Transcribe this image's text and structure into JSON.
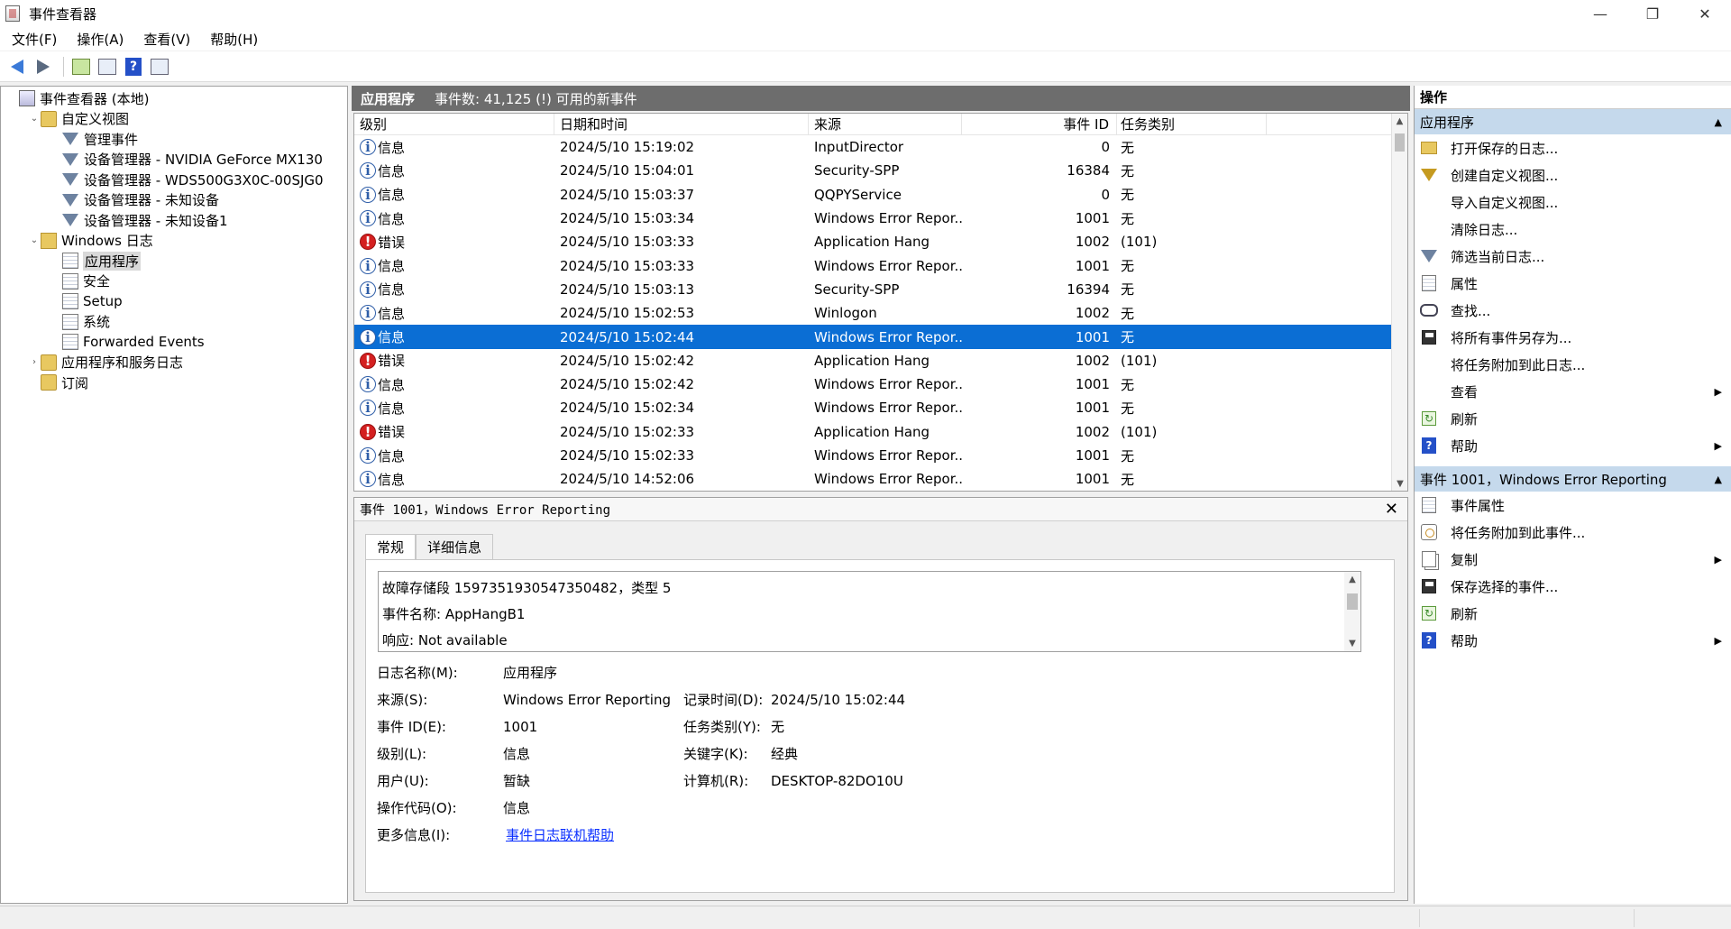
{
  "window": {
    "title": "事件查看器",
    "minimize": "—",
    "maximize": "❐",
    "close": "✕"
  },
  "menu": [
    "文件(F)",
    "操作(A)",
    "查看(V)",
    "帮助(H)"
  ],
  "toolbar": {
    "back": "back-arrow-icon",
    "forward": "forward-arrow-icon",
    "help": "?"
  },
  "tree": [
    {
      "label": "事件查看器 (本地)",
      "indent": 0,
      "icon": "computer-icon",
      "expander": ""
    },
    {
      "label": "自定义视图",
      "indent": 1,
      "icon": "folder-icon",
      "expander": "⌄"
    },
    {
      "label": "管理事件",
      "indent": 2,
      "icon": "filter-icon",
      "expander": ""
    },
    {
      "label": "设备管理器 - NVIDIA GeForce MX130",
      "indent": 2,
      "icon": "filter-icon",
      "expander": ""
    },
    {
      "label": "设备管理器 - WDS500G3X0C-00SJG0",
      "indent": 2,
      "icon": "filter-icon",
      "expander": ""
    },
    {
      "label": "设备管理器 - 未知设备",
      "indent": 2,
      "icon": "filter-icon",
      "expander": ""
    },
    {
      "label": "设备管理器 - 未知设备1",
      "indent": 2,
      "icon": "filter-icon",
      "expander": ""
    },
    {
      "label": "Windows 日志",
      "indent": 1,
      "icon": "windows-log-folder-icon",
      "expander": "⌄"
    },
    {
      "label": "应用程序",
      "indent": 2,
      "icon": "log-icon",
      "expander": "",
      "selected": true
    },
    {
      "label": "安全",
      "indent": 2,
      "icon": "log-icon",
      "expander": ""
    },
    {
      "label": "Setup",
      "indent": 2,
      "icon": "log-icon",
      "expander": ""
    },
    {
      "label": "系统",
      "indent": 2,
      "icon": "log-icon",
      "expander": ""
    },
    {
      "label": "Forwarded Events",
      "indent": 2,
      "icon": "log-icon",
      "expander": ""
    },
    {
      "label": "应用程序和服务日志",
      "indent": 1,
      "icon": "folder-icon",
      "expander": "›"
    },
    {
      "label": "订阅",
      "indent": 1,
      "icon": "folder-icon",
      "expander": ""
    }
  ],
  "list": {
    "title": "应用程序",
    "summary": "事件数: 41,125 (!) 可用的新事件",
    "columns": [
      "级别",
      "日期和时间",
      "来源",
      "事件 ID",
      "任务类别"
    ],
    "rows": [
      {
        "level": "信息",
        "type": "info",
        "datetime": "2024/5/10 15:19:02",
        "source": "InputDirector",
        "event_id": "0",
        "task": "无"
      },
      {
        "level": "信息",
        "type": "info",
        "datetime": "2024/5/10 15:04:01",
        "source": "Security-SPP",
        "event_id": "16384",
        "task": "无"
      },
      {
        "level": "信息",
        "type": "info",
        "datetime": "2024/5/10 15:03:37",
        "source": "QQPYService",
        "event_id": "0",
        "task": "无"
      },
      {
        "level": "信息",
        "type": "info",
        "datetime": "2024/5/10 15:03:34",
        "source": "Windows Error Repor...",
        "event_id": "1001",
        "task": "无"
      },
      {
        "level": "错误",
        "type": "error",
        "datetime": "2024/5/10 15:03:33",
        "source": "Application Hang",
        "event_id": "1002",
        "task": "(101)"
      },
      {
        "level": "信息",
        "type": "info",
        "datetime": "2024/5/10 15:03:33",
        "source": "Windows Error Repor...",
        "event_id": "1001",
        "task": "无"
      },
      {
        "level": "信息",
        "type": "info",
        "datetime": "2024/5/10 15:03:13",
        "source": "Security-SPP",
        "event_id": "16394",
        "task": "无"
      },
      {
        "level": "信息",
        "type": "info",
        "datetime": "2024/5/10 15:02:53",
        "source": "Winlogon",
        "event_id": "1002",
        "task": "无"
      },
      {
        "level": "信息",
        "type": "info",
        "datetime": "2024/5/10 15:02:44",
        "source": "Windows Error Repor...",
        "event_id": "1001",
        "task": "无",
        "selected": true
      },
      {
        "level": "错误",
        "type": "error",
        "datetime": "2024/5/10 15:02:42",
        "source": "Application Hang",
        "event_id": "1002",
        "task": "(101)"
      },
      {
        "level": "信息",
        "type": "info",
        "datetime": "2024/5/10 15:02:42",
        "source": "Windows Error Repor...",
        "event_id": "1001",
        "task": "无"
      },
      {
        "level": "信息",
        "type": "info",
        "datetime": "2024/5/10 15:02:34",
        "source": "Windows Error Repor...",
        "event_id": "1001",
        "task": "无"
      },
      {
        "level": "错误",
        "type": "error",
        "datetime": "2024/5/10 15:02:33",
        "source": "Application Hang",
        "event_id": "1002",
        "task": "(101)"
      },
      {
        "level": "信息",
        "type": "info",
        "datetime": "2024/5/10 15:02:33",
        "source": "Windows Error Repor...",
        "event_id": "1001",
        "task": "无"
      },
      {
        "level": "信息",
        "type": "info",
        "datetime": "2024/5/10 14:52:06",
        "source": "Windows Error Repor...",
        "event_id": "1001",
        "task": "无"
      }
    ]
  },
  "detail": {
    "title": "事件 1001，Windows Error Reporting",
    "close": "✕",
    "tabs": [
      "常规",
      "详细信息"
    ],
    "description": [
      "故障存储段 1597351930547350482，类型 5",
      "事件名称: AppHangB1",
      "响应: Not available"
    ],
    "props": {
      "log_name_label": "日志名称(M):",
      "log_name": "应用程序",
      "source_label": "来源(S):",
      "source": "Windows Error Reporting",
      "logged_label": "记录时间(D):",
      "logged": "2024/5/10 15:02:44",
      "event_id_label": "事件 ID(E):",
      "event_id": "1001",
      "task_label": "任务类别(Y):",
      "task": "无",
      "level_label": "级别(L):",
      "level": "信息",
      "keywords_label": "关键字(K):",
      "keywords": "经典",
      "user_label": "用户(U):",
      "user": "暂缺",
      "computer_label": "计算机(R):",
      "computer": "DESKTOP-82DO10U",
      "opcode_label": "操作代码(O):",
      "opcode": "信息",
      "more_label": "更多信息(I):",
      "more_link": "事件日志联机帮助"
    }
  },
  "actions": {
    "title": "操作",
    "section1": {
      "title": "应用程序",
      "items": [
        {
          "label": "打开保存的日志...",
          "icon": "open-folder-icon",
          "sub": false
        },
        {
          "label": "创建自定义视图...",
          "icon": "create-filter-icon",
          "sub": false
        },
        {
          "label": "导入自定义视图...",
          "icon": "",
          "sub": false
        },
        {
          "label": "清除日志...",
          "icon": "",
          "sub": false
        },
        {
          "label": "筛选当前日志...",
          "icon": "filter-icon",
          "sub": false
        },
        {
          "label": "属性",
          "icon": "properties-icon",
          "sub": false
        },
        {
          "label": "查找...",
          "icon": "find-icon",
          "sub": false
        },
        {
          "label": "将所有事件另存为...",
          "icon": "save-icon",
          "sub": false
        },
        {
          "label": "将任务附加到此日志...",
          "icon": "",
          "sub": false
        },
        {
          "label": "查看",
          "icon": "",
          "sub": true
        },
        {
          "label": "刷新",
          "icon": "refresh-icon",
          "sub": false
        },
        {
          "label": "帮助",
          "icon": "help-icon",
          "sub": true
        }
      ]
    },
    "section2": {
      "title": "事件 1001，Windows Error Reporting",
      "items": [
        {
          "label": "事件属性",
          "icon": "event-properties-icon",
          "sub": false
        },
        {
          "label": "将任务附加到此事件...",
          "icon": "attach-task-icon",
          "sub": false
        },
        {
          "label": "复制",
          "icon": "copy-icon",
          "sub": true
        },
        {
          "label": "保存选择的事件...",
          "icon": "save-icon",
          "sub": false
        },
        {
          "label": "刷新",
          "icon": "refresh-icon",
          "sub": false
        },
        {
          "label": "帮助",
          "icon": "help-icon",
          "sub": true
        }
      ]
    }
  }
}
